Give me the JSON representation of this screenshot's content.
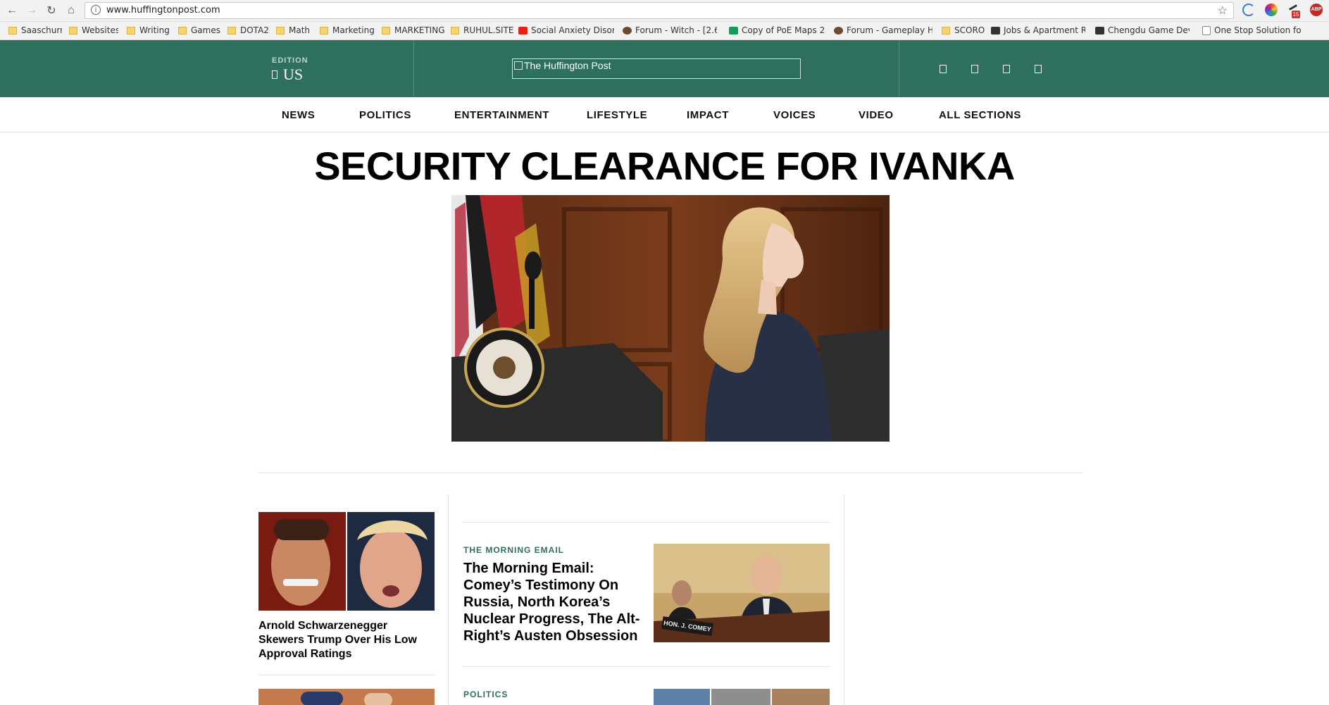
{
  "browser": {
    "url": "www.huffingtonpost.com",
    "bookmarks": [
      {
        "label": "Saaschurn",
        "type": "folder"
      },
      {
        "label": "Websites",
        "type": "folder"
      },
      {
        "label": "Writing",
        "type": "folder"
      },
      {
        "label": "Games",
        "type": "folder"
      },
      {
        "label": "DOTA2",
        "type": "folder"
      },
      {
        "label": "Math",
        "type": "folder"
      },
      {
        "label": "Marketing",
        "type": "folder"
      },
      {
        "label": "MARKETING",
        "type": "folder"
      },
      {
        "label": "RUHUL.SITE",
        "type": "folder"
      },
      {
        "label": "Social Anxiety Disorde",
        "type": "youtube"
      },
      {
        "label": "Forum - Witch - [2.6]",
        "type": "site"
      },
      {
        "label": "Copy of PoE Maps 2.4",
        "type": "sheets"
      },
      {
        "label": "Forum - Gameplay He",
        "type": "site"
      },
      {
        "label": "SCORO",
        "type": "folder"
      },
      {
        "label": "Jobs & Apartment Re",
        "type": "site"
      },
      {
        "label": "Chengdu Game Deve",
        "type": "site"
      },
      {
        "label": "One Stop Solution for",
        "type": "page"
      }
    ],
    "extension_badge": "15",
    "adblock_label": "ABP"
  },
  "header": {
    "edition_label": "EDITION",
    "edition_value": "US",
    "logo_alt": "The Huffington Post"
  },
  "sections": [
    "NEWS",
    "POLITICS",
    "ENTERTAINMENT",
    "LIFESTYLE",
    "IMPACT",
    "VOICES",
    "VIDEO",
    "ALL SECTIONS"
  ],
  "main": {
    "headline": "SECURITY CLEARANCE FOR IVANKA"
  },
  "stories": {
    "left_1": {
      "title": "Arnold Schwarzenegger Skewers Trump Over His Low Approval Ratings"
    },
    "middle_1": {
      "kicker": "THE MORNING EMAIL",
      "title": "The Morning Email: Comey’s Testimony On Russia, North Korea’s Nuclear Progress, The Alt-Right’s Austen Obsession",
      "nameplate": "HON. J. COMEY"
    },
    "middle_2": {
      "kicker": "POLITICS"
    }
  },
  "colors": {
    "brand_green": "#2e6f5e",
    "kicker_green": "#2e6f5e"
  }
}
